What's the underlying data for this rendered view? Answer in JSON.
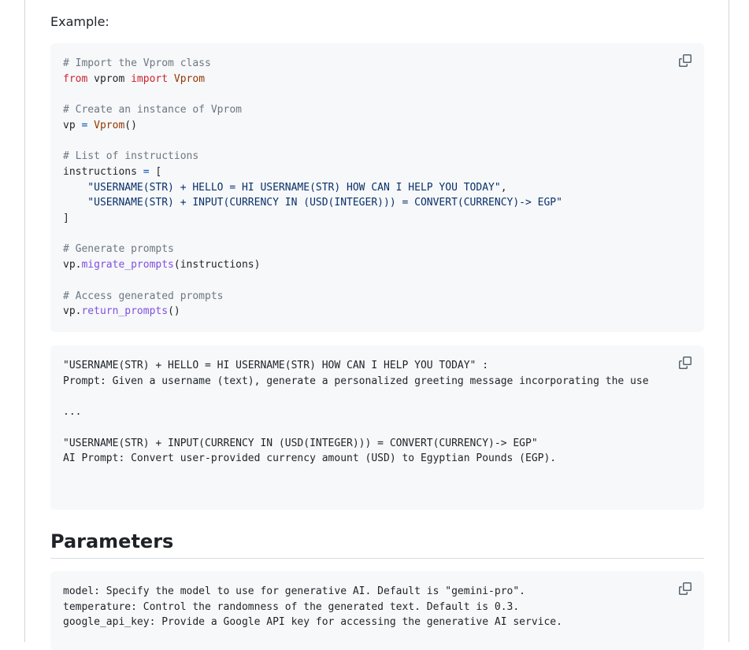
{
  "example_label": "Example:",
  "code1": {
    "comment_import": "# Import the Vprom class",
    "kw_from": "from",
    "mod_vprom": " vprom ",
    "kw_import": "import",
    "cls_vprom": " Vprom",
    "comment_create": "# Create an instance of Vprom",
    "var_vp": "vp ",
    "op_eq": "=",
    "cls_vprom_call": " Vprom",
    "parens": "()",
    "comment_list": "# List of instructions",
    "var_instructions": "instructions ",
    "op_eq2": "=",
    "open_bracket": " [",
    "str1": "    \"USERNAME(STR) + HELLO = HI USERNAME(STR) HOW CAN I HELP YOU TODAY\"",
    "comma": ",",
    "str2": "    \"USERNAME(STR) + INPUT(CURRENCY IN (USD(INTEGER))) = CONVERT(CURRENCY)-> EGP\"",
    "close_bracket": "]",
    "comment_generate": "# Generate prompts",
    "vp_dot": "vp.",
    "fn_migrate": "migrate_prompts",
    "migrate_args": "(instructions)",
    "comment_access": "# Access generated prompts",
    "vp_dot2": "vp.",
    "fn_return": "return_prompts",
    "return_args": "()"
  },
  "code2": {
    "line1": "\"USERNAME(STR) + HELLO = HI USERNAME(STR) HOW CAN I HELP YOU TODAY\" :",
    "line2": "Prompt: Given a username (text), generate a personalized greeting message incorporating the use",
    "line3": "...",
    "line4": "\"USERNAME(STR) + INPUT(CURRENCY IN (USD(INTEGER))) = CONVERT(CURRENCY)-> EGP\"",
    "line5": "AI Prompt: Convert user-provided currency amount (USD) to Egyptian Pounds (EGP)."
  },
  "parameters_heading": "Parameters",
  "code3": {
    "line1": "model: Specify the model to use for generative AI. Default is \"gemini-pro\".",
    "line2": "temperature: Control the randomness of the generated text. Default is 0.3.",
    "line3": "google_api_key: Provide a Google API key for accessing the generative AI service."
  },
  "icons": {
    "copy": "copy-icon"
  }
}
